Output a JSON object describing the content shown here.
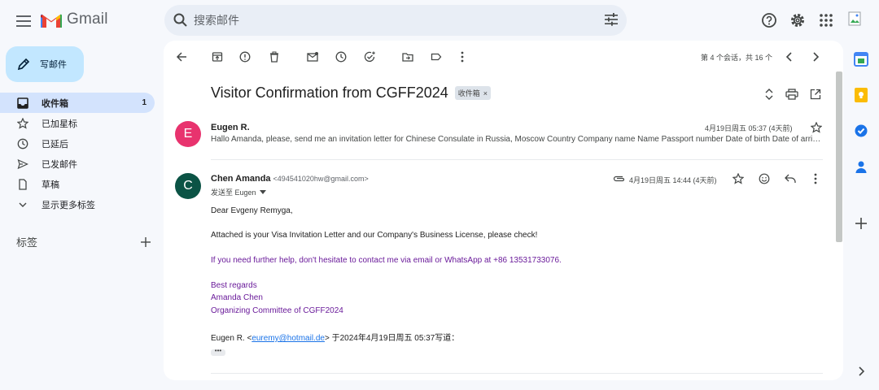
{
  "app": {
    "logo_text": "Gmail"
  },
  "search": {
    "placeholder": "搜索邮件"
  },
  "compose": {
    "label": "写邮件"
  },
  "nav": {
    "items": [
      {
        "label": "收件箱",
        "count": "1",
        "icon": "inbox-icon",
        "active": true
      },
      {
        "label": "已加星标",
        "icon": "star-icon"
      },
      {
        "label": "已延后",
        "icon": "clock-icon"
      },
      {
        "label": "已发邮件",
        "icon": "send-icon"
      },
      {
        "label": "草稿",
        "icon": "draft-icon"
      },
      {
        "label": "显示更多标签",
        "icon": "chevron-down-icon"
      }
    ],
    "labels_heading": "标签"
  },
  "toolbar": {
    "paging": "第 4 个会话，共 16 个"
  },
  "thread": {
    "subject": "Visitor Confirmation from CGFF2024",
    "chip": "收件箱",
    "chip_close": "×"
  },
  "messages": [
    {
      "avatar_letter": "E",
      "avatar_color": "#e8336e",
      "sender": "Eugen R.",
      "date": "4月19日周五 05:37 (4天前)",
      "snippet": "Hallo Amanda, please, send me an invitation letter for Chinese Consulate in Russia, Moscow Country Company name Name Passport number Date of birth Date of arrival Date of departure"
    },
    {
      "avatar_letter": "C",
      "avatar_color": "#0b5345",
      "sender": "Chen Amanda",
      "sender_email": "<494541020hw@gmail.com>",
      "date": "4月19日周五 14:44 (4天前)",
      "to_line": "发送至 Eugen",
      "body": {
        "greeting": "Dear Evgeny Remyga,",
        "line1": "Attached is your Visa Invitation Letter and our Company's Business License, please check!",
        "line2": "If you need further help, don't hesitate to contact me via email or WhatsApp at +86 13531733076.",
        "sign1": "Best regards",
        "sign2": "Amanda Chen",
        "sign3": "Organizing Committee of CGFF2024",
        "quote_prefix": "Eugen R. <",
        "quote_email": "euremy@hotmail.de",
        "quote_suffix": "> 于2024年4月19日周五 05:37写道：",
        "dots": "•••"
      }
    }
  ]
}
